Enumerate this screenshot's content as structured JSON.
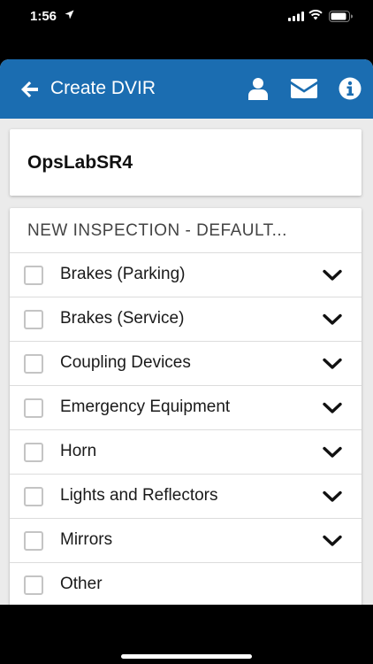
{
  "status_bar": {
    "time": "1:56"
  },
  "header": {
    "title": "Create DVIR",
    "brand_color": "#1b6db1"
  },
  "vehicle": {
    "name": "OpsLabSR4"
  },
  "inspection": {
    "header": "NEW INSPECTION - DEFAULT...",
    "items": [
      {
        "label": "Brakes (Parking)",
        "checked": false,
        "expandable": true
      },
      {
        "label": "Brakes (Service)",
        "checked": false,
        "expandable": true
      },
      {
        "label": "Coupling Devices",
        "checked": false,
        "expandable": true
      },
      {
        "label": "Emergency Equipment",
        "checked": false,
        "expandable": true
      },
      {
        "label": "Horn",
        "checked": false,
        "expandable": true
      },
      {
        "label": "Lights and Reflectors",
        "checked": false,
        "expandable": true
      },
      {
        "label": "Mirrors",
        "checked": false,
        "expandable": true
      },
      {
        "label": "Other",
        "checked": false,
        "expandable": false
      }
    ]
  }
}
